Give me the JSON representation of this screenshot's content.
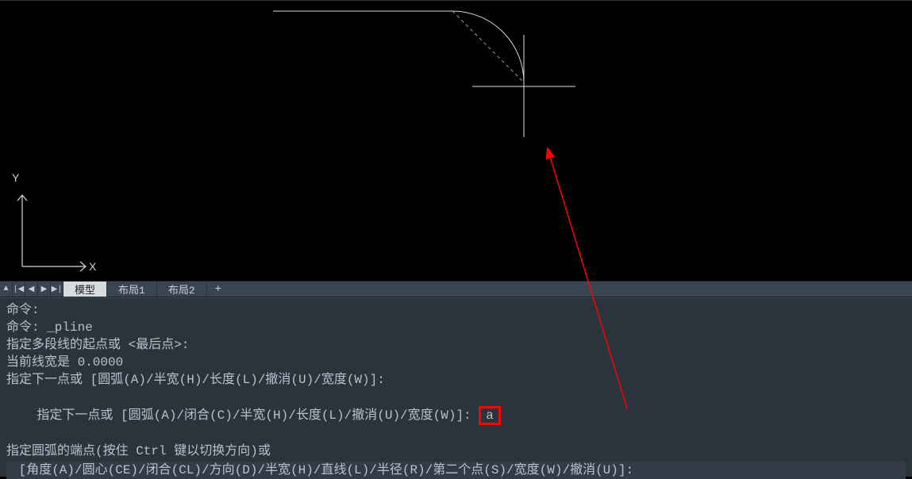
{
  "viewport": {
    "ucs": {
      "x_label": "X",
      "y_label": "Y"
    }
  },
  "tabs": {
    "nav_close": "▲",
    "nav_first": "|◀",
    "nav_prev": "◀",
    "nav_next": "▶",
    "nav_last": "▶|",
    "items": [
      {
        "label": "模型",
        "active": true
      },
      {
        "label": "布局1",
        "active": false
      },
      {
        "label": "布局2",
        "active": false
      }
    ],
    "add": "+"
  },
  "command_history": {
    "l0": "命令:",
    "l1": "命令: _pline",
    "l2": "指定多段线的起点或 <最后点>:",
    "l3": "当前线宽是 0.0000",
    "l4": "指定下一点或 [圆弧(A)/半宽(H)/长度(L)/撤消(U)/宽度(W)]:",
    "l5_prefix": "指定下一点或 [圆弧(A)/闭合(C)/半宽(H)/长度(L)/撤消(U)/宽度(W)]: ",
    "l5_highlight": "a",
    "l6": "指定圆弧的端点(按住 Ctrl 键以切换方向)或",
    "l7_input": " [角度(A)/圆心(CE)/闭合(CL)/方向(D)/半宽(H)/直线(L)/半径(R)/第二个点(S)/宽度(W)/撤消(U)]:"
  },
  "annotation": {
    "arrow_color": "#ff0000"
  }
}
